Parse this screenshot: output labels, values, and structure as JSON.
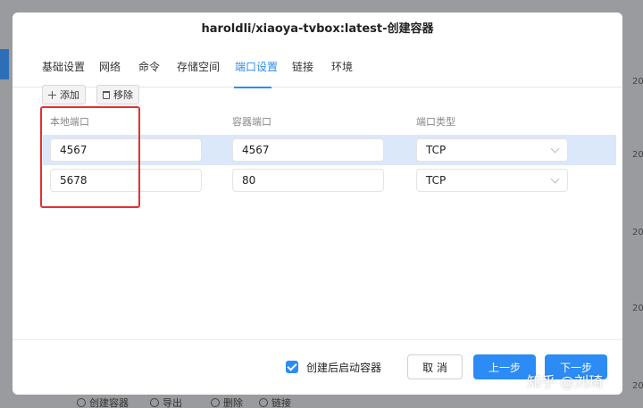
{
  "dialog": {
    "title": "haroldli/xiaoya-tvbox:latest-创建容器"
  },
  "tabs": [
    {
      "label": "基础设置"
    },
    {
      "label": "网络"
    },
    {
      "label": "命令"
    },
    {
      "label": "存储空间"
    },
    {
      "label": "端口设置"
    },
    {
      "label": "链接"
    },
    {
      "label": "环境"
    }
  ],
  "toolbar": {
    "add_label": "添加",
    "remove_label": "移除"
  },
  "table": {
    "columns": [
      "本地端口",
      "容器端口",
      "端口类型"
    ],
    "rows": [
      {
        "local": "4567",
        "container": "4567",
        "type": "TCP"
      },
      {
        "local": "5678",
        "container": "80",
        "type": "TCP"
      }
    ]
  },
  "footer": {
    "start_after_create": "创建后启动容器",
    "cancel": "取 消",
    "prev": "上一步",
    "next": "下一步"
  },
  "background": {
    "dates": [
      "20",
      "20",
      "20",
      "20",
      "20",
      "20"
    ],
    "bottom_actions": [
      "创建容器",
      "导出",
      "删除",
      "链接"
    ]
  },
  "watermark": "知乎 @刘琦",
  "colors": {
    "accent": "#2c8bf5",
    "highlight_row": "#dbe8f9",
    "annotation_red": "#e53030"
  }
}
